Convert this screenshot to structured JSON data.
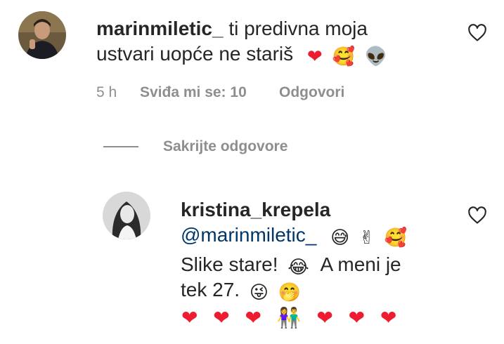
{
  "comment": {
    "username": "marinmiletic_",
    "text_line1": "ti predivna moja",
    "text_line2": "ustvari uopće ne stariš",
    "emojis": [
      "❤",
      "🥰",
      "👽"
    ],
    "time": "5 h",
    "likes": "Sviđa mi se: 10",
    "reply": "Odgovori"
  },
  "toggle_replies": "Sakrijte odgovore",
  "reply_comment": {
    "username": "kristina_krepela",
    "mention": "@marinmiletic_",
    "mention_emojis": [
      "😅",
      "✌",
      "🥰"
    ],
    "line2": "Slike stare!",
    "line2_emoji": "😂",
    "line2b": "A meni je",
    "line3": "tek 27.",
    "line3_emojis": [
      "😜",
      "🤭"
    ],
    "hearts": [
      "❤",
      "❤",
      "❤",
      "👫",
      "❤",
      "❤",
      "❤"
    ]
  },
  "colors": {
    "heart": "#ed1c30",
    "mention": "#00376b",
    "meta": "#8e8e8e"
  }
}
